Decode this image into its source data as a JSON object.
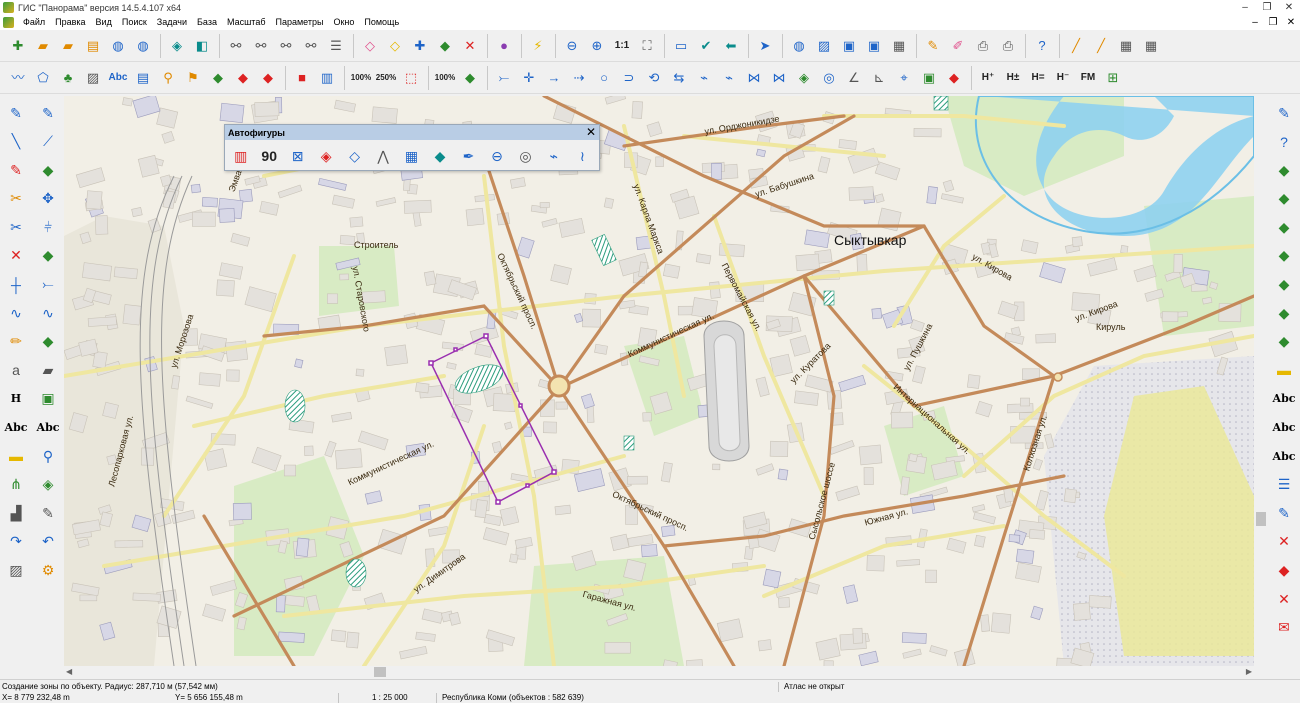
{
  "window": {
    "title": "ГИС \"Панорама\" версия 14.5.4.107 x64",
    "controls": [
      "–",
      "❐",
      "✕"
    ]
  },
  "menu": {
    "items": [
      "Файл",
      "Правка",
      "Вид",
      "Поиск",
      "Задачи",
      "База",
      "Масштаб",
      "Параметры",
      "Окно",
      "Помощь"
    ],
    "mdi_controls": [
      "–",
      "❐",
      "✕"
    ]
  },
  "toolbar1": {
    "scale_label": "1:1"
  },
  "toolbar2": {
    "text_tool_label": "Abc",
    "zoom_100_label": "100%",
    "zoom_250_label": "250%",
    "zoom_100b_label": "100%",
    "height_labels": [
      "H⁺",
      "H±",
      "H=",
      "H⁻"
    ],
    "fm_label": "FM"
  },
  "leftpanel": {
    "height_label": "H",
    "abc_labels": [
      "Abc",
      "Abc"
    ],
    "text_a_label": "a"
  },
  "rightpanel": {
    "abc_labels": [
      "Abc",
      "Abc",
      "Abc"
    ]
  },
  "autofigures": {
    "title": "Автофигуры",
    "close": "✕",
    "angle_label": "90"
  },
  "map": {
    "city_label": "Сыктывкар",
    "street_labels": [
      {
        "text": "ул. Орджоникидзе"
      },
      {
        "text": "ул. Карла Маркса"
      },
      {
        "text": "ул. Бабушкина"
      },
      {
        "text": "Октябрьский просп."
      },
      {
        "text": "Первомайская ул."
      },
      {
        "text": "Строитель"
      },
      {
        "text": "ул. Старовского"
      },
      {
        "text": "Коммунистическая ул."
      },
      {
        "text": "ул. Кирова"
      },
      {
        "text": "ул. Кирова"
      },
      {
        "text": "Кируль"
      },
      {
        "text": "ул. Морозова"
      },
      {
        "text": "ул. Куратова"
      },
      {
        "text": "ул. Пушкина"
      },
      {
        "text": "Интернациональная ул."
      },
      {
        "text": "Колхозная ул."
      },
      {
        "text": "Лесопарковая ул."
      },
      {
        "text": "Коммунистическая ул."
      },
      {
        "text": "Октябрьский просп."
      },
      {
        "text": "Сысольское шоссе"
      },
      {
        "text": "Южная ул."
      },
      {
        "text": "ул. Димитрова"
      },
      {
        "text": "Гаражная ул."
      },
      {
        "text": "Эмва"
      }
    ]
  },
  "status": {
    "message": "Создание зоны по объекту. Радиус: 287,710 м (57,542 мм)",
    "atlas": "Атлас не открыт",
    "coord_x": "X= 8 779 232,48 m",
    "coord_y": "Y= 5 656 155,48 m",
    "scale": "1 : 25 000",
    "map_name": "Республика Коми   (объектов : 582 639)"
  },
  "colors": {
    "map_background": "#f4f1ea",
    "major_road": "#c48a5a",
    "minor_road": "#efe7a0",
    "water": "#8fd1ef",
    "park": "#d8ebc4",
    "zone_outline": "#9a2fb0",
    "autofig_titlebar": "#b9cde5"
  }
}
